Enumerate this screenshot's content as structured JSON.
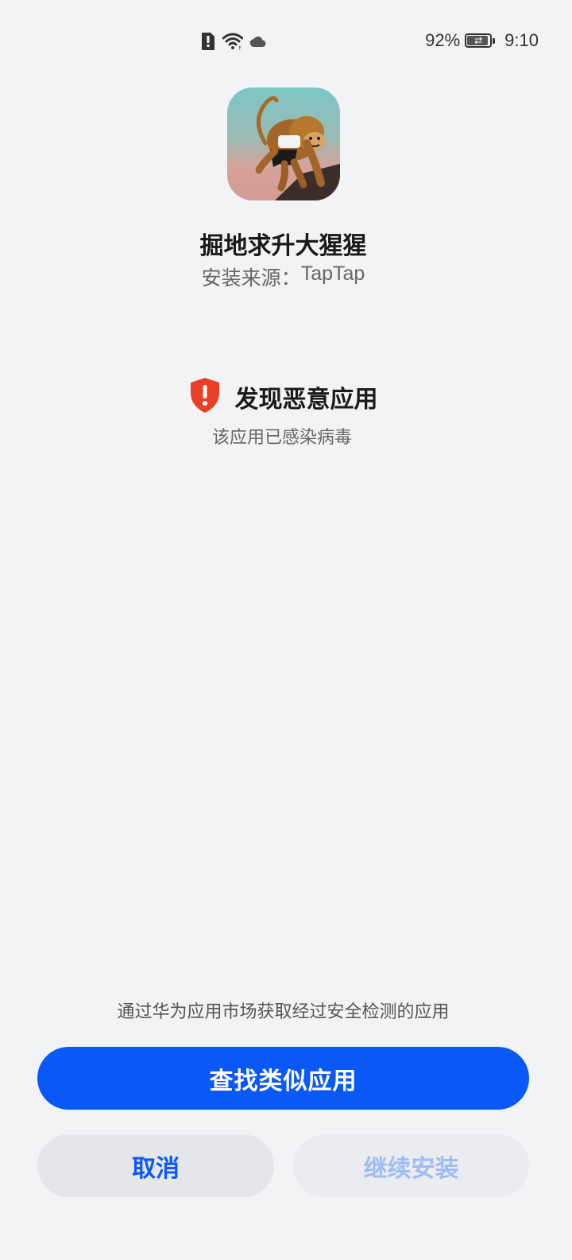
{
  "status_bar": {
    "battery_percent": "92%",
    "battery_level": 0.92,
    "time": "9:10",
    "icons": [
      "sim-alert-icon",
      "wifi-icon",
      "cloud-icon",
      "battery-charging-icon"
    ]
  },
  "app": {
    "icon": "gorilla-app-icon",
    "name": "掘地求升大猩猩",
    "source_label": "安装来源：",
    "source_value": "TapTap"
  },
  "warning": {
    "icon": "shield-alert-icon",
    "title": "发现恶意应用",
    "description": "该应用已感染病毒"
  },
  "footer": {
    "hint": "通过华为应用市场获取经过安全检测的应用",
    "primary_button": "查找类似应用",
    "cancel_button": "取消",
    "continue_button": "继续安装"
  },
  "colors": {
    "background": "#f1f3f5",
    "accent": "#0a59f7",
    "danger": "#e84026",
    "disabled_text": "#9fbcf3"
  }
}
